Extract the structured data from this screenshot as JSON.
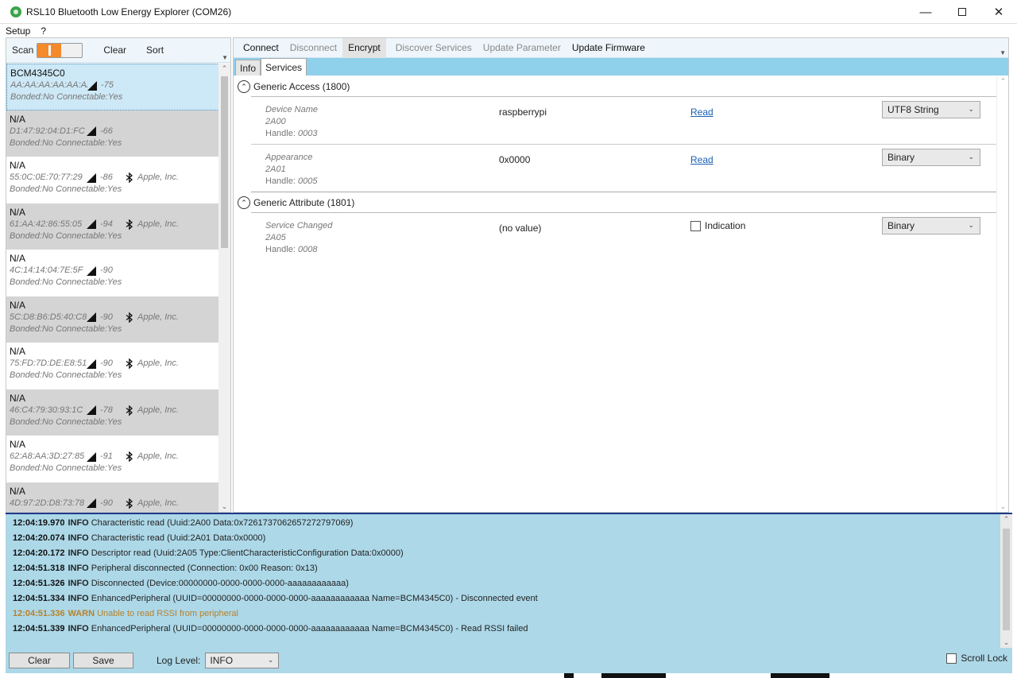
{
  "window": {
    "title": "RSL10 Bluetooth Low Energy Explorer (COM26)",
    "minimize_icon": "minimize-icon",
    "maximize_icon": "maximize-icon",
    "close_icon": "close-icon"
  },
  "menu": {
    "items": [
      "Setup",
      "?"
    ]
  },
  "left_toolbar": {
    "scan_label": "Scan",
    "scan_on": true,
    "clear_label": "Clear",
    "sort_label": "Sort"
  },
  "devices": [
    {
      "name": "BCM4345C0",
      "address": "AA:AA:AA:AA:AA:AA",
      "rssi": "-75",
      "vendor": "",
      "bonding": "Bonded:No Connectable:Yes",
      "style": "selected"
    },
    {
      "name": "N/A",
      "address": "D1:47:92:04:D1:FC",
      "rssi": "-66",
      "vendor": "",
      "bonding": "Bonded:No Connectable:Yes",
      "style": "grey"
    },
    {
      "name": "N/A",
      "address": "55:0C:0E:70:77:29",
      "rssi": "-86",
      "vendor": "Apple, Inc.",
      "bonding": "Bonded:No Connectable:Yes",
      "style": "white"
    },
    {
      "name": "N/A",
      "address": "61:AA:42:86:55:05",
      "rssi": "-94",
      "vendor": "Apple, Inc.",
      "bonding": "Bonded:No Connectable:Yes",
      "style": "grey"
    },
    {
      "name": "N/A",
      "address": "4C:14:14:04:7E:5F",
      "rssi": "-90",
      "vendor": "",
      "bonding": "Bonded:No Connectable:Yes",
      "style": "white"
    },
    {
      "name": "N/A",
      "address": "5C:D8:B6:D5:40:C8",
      "rssi": "-90",
      "vendor": "Apple, Inc.",
      "bonding": "Bonded:No Connectable:Yes",
      "style": "grey"
    },
    {
      "name": "N/A",
      "address": "75:FD:7D:DE:E8:51",
      "rssi": "-90",
      "vendor": "Apple, Inc.",
      "bonding": "Bonded:No Connectable:Yes",
      "style": "white"
    },
    {
      "name": "N/A",
      "address": "46:C4:79:30:93:1C",
      "rssi": "-78",
      "vendor": "Apple, Inc.",
      "bonding": "Bonded:No Connectable:Yes",
      "style": "grey"
    },
    {
      "name": "N/A",
      "address": "62:A8:AA:3D:27:85",
      "rssi": "-91",
      "vendor": "Apple, Inc.",
      "bonding": "Bonded:No Connectable:Yes",
      "style": "white"
    },
    {
      "name": "N/A",
      "address": "4D:97:2D:D8:73:78",
      "rssi": "-90",
      "vendor": "Apple, Inc.",
      "bonding": "",
      "style": "grey"
    }
  ],
  "right_toolbar": {
    "connect": "Connect",
    "disconnect": "Disconnect",
    "encrypt": "Encrypt",
    "discover": "Discover Services",
    "update_param": "Update Parameter",
    "update_fw": "Update Firmware"
  },
  "tabs": {
    "info": "Info",
    "services": "Services"
  },
  "services": [
    {
      "title": "Generic Access (1800)",
      "characteristics": [
        {
          "name": "Device Name",
          "uuid": "2A00",
          "handle_label": "Handle:",
          "handle": "0003",
          "value": "raspberrypi",
          "action": "read",
          "action_label": "Read",
          "format": "UTF8 String"
        },
        {
          "name": "Appearance",
          "uuid": "2A01",
          "handle_label": "Handle:",
          "handle": "0005",
          "value": "0x0000",
          "action": "read",
          "action_label": "Read",
          "format": "Binary"
        }
      ]
    },
    {
      "title": "Generic Attribute (1801)",
      "characteristics": [
        {
          "name": "Service Changed",
          "uuid": "2A05",
          "handle_label": "Handle:",
          "handle": "0008",
          "value": "(no value)",
          "action": "indication",
          "action_label": "Indication",
          "format": "Binary"
        }
      ]
    }
  ],
  "log": [
    {
      "time": "12:04:19.970",
      "level": "INFO",
      "message": "Characteristic read (Uuid:2A00 Data:0x7261737062657272797069)"
    },
    {
      "time": "12:04:20.074",
      "level": "INFO",
      "message": "Characteristic read (Uuid:2A01 Data:0x0000)"
    },
    {
      "time": "12:04:20.172",
      "level": "INFO",
      "message": "Descriptor read (Uuid:2A05 Type:ClientCharacteristicConfiguration Data:0x0000)"
    },
    {
      "time": "12:04:51.318",
      "level": "INFO",
      "message": "Peripheral disconnected (Connection: 0x00 Reason: 0x13)"
    },
    {
      "time": "12:04:51.326",
      "level": "INFO",
      "message": "Disconnected (Device:00000000-0000-0000-0000-aaaaaaaaaaaa)"
    },
    {
      "time": "12:04:51.334",
      "level": "INFO",
      "message": "EnhancedPeripheral (UUID=00000000-0000-0000-0000-aaaaaaaaaaaa Name=BCM4345C0) - Disconnected event"
    },
    {
      "time": "12:04:51.336",
      "level": "WARN",
      "message": "Unable to read RSSI from peripheral"
    },
    {
      "time": "12:04:51.339",
      "level": "INFO",
      "message": "EnhancedPeripheral (UUID=00000000-0000-0000-0000-aaaaaaaaaaaa Name=BCM4345C0) - Read RSSI failed"
    }
  ],
  "bottom": {
    "clear_label": "Clear",
    "save_label": "Save",
    "log_level_label": "Log Level:",
    "log_level_value": "INFO",
    "scroll_lock_label": "Scroll Lock"
  },
  "colors": {
    "accent": "#f58a2a",
    "log_bg": "#add8e8",
    "warn": "#b8822a",
    "selected": "#cde8f6"
  }
}
